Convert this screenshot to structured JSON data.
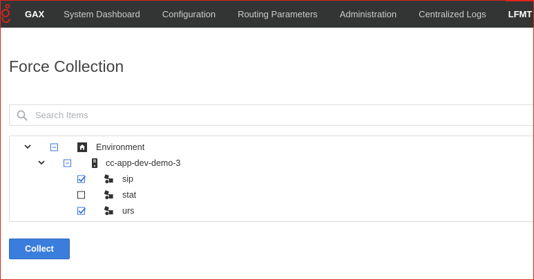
{
  "nav": {
    "brand": "GAX",
    "items": [
      {
        "label": "System Dashboard"
      },
      {
        "label": "Configuration"
      },
      {
        "label": "Routing Parameters"
      },
      {
        "label": "Administration"
      },
      {
        "label": "Centralized Logs"
      },
      {
        "label": "LFMT"
      }
    ],
    "active": "LFMT",
    "logo_icon": "genesys-logo-icon",
    "accent_color": "#e2231a",
    "bar_color": "#333535"
  },
  "page": {
    "title": "Force Collection"
  },
  "search": {
    "placeholder": "Search Items",
    "value": ""
  },
  "tree": {
    "nodes": [
      {
        "label": "Environment",
        "icon": "home-icon",
        "state": "partial",
        "expanded": true
      },
      {
        "label": "cc-app-dev-demo-3",
        "icon": "server-icon",
        "state": "partial",
        "expanded": true
      },
      {
        "label": "sip",
        "icon": "application-icon",
        "state": "checked"
      },
      {
        "label": "stat",
        "icon": "application-icon",
        "state": "unchecked"
      },
      {
        "label": "urs",
        "icon": "application-icon",
        "state": "checked"
      }
    ]
  },
  "actions": {
    "collect_label": "Collect",
    "button_color": "#3b7ddd"
  }
}
